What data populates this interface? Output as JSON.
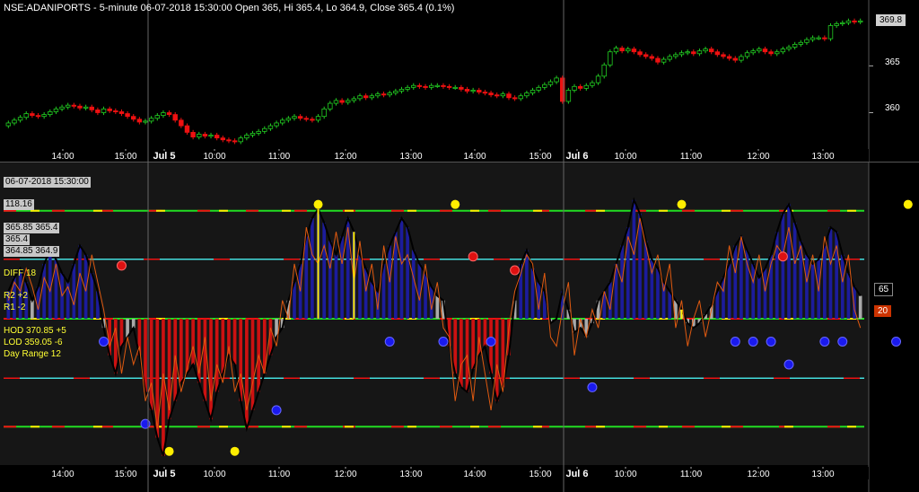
{
  "title": "NSE:ADANIPORTS - 5-minute 06-07-2018 15:30:00 Open 365, Hi 365.4, Lo 364.9, Close 365.4 (0.1%)",
  "price_axis": {
    "ticks": [
      "365",
      "360"
    ],
    "last_value": "369.8"
  },
  "time_axis": [
    "14:00",
    "15:00",
    "Jul 5",
    "10:00",
    "11:00",
    "12:00",
    "13:00",
    "14:00",
    "15:00",
    "Jul 6",
    "10:00",
    "11:00",
    "12:00",
    "13:00"
  ],
  "indicator_panel": {
    "datetime": "06-07-2018 15:30:00",
    "value_118": "118.16",
    "info_lines": [
      "365.85  365.4",
      "365.4",
      "364.85  364.9"
    ],
    "diff_label": "DIFF  18",
    "r2_label": "R2  +2",
    "r1_label": "R1  -2",
    "hod_label": "HOD  370.85  +5",
    "lod_label": "LOD  359.05   -6",
    "day_range_label": "Day Range    12",
    "right_value_1": "65",
    "right_value_2": "20"
  },
  "colors": {
    "up": "#22cc22",
    "down": "#ee1111",
    "green_line": "#22dd22",
    "cyan_line": "#44dddd",
    "yellow": "#ffee00",
    "navy_fill": "#1c1c9c",
    "red_fill": "#cc1111",
    "gray_fill": "#aaaaaa",
    "marker_blue": "#1a1aee",
    "marker_red": "#dd1111"
  },
  "chart_data": [
    {
      "type": "candlestick",
      "title": "NSE:ADANIPORTS - 5-minute",
      "y_ticks": [
        365,
        360
      ],
      "ylim": [
        356.5,
        370.5
      ],
      "last": 369.8,
      "close": [
        358.9,
        359.2,
        359.5,
        359.9,
        359.7,
        359.6,
        359.8,
        360.1,
        360.4,
        360.6,
        360.8,
        360.7,
        360.5,
        360.6,
        360.3,
        360.0,
        360.4,
        360.2,
        360.1,
        359.9,
        359.6,
        359.3,
        359.0,
        359.1,
        359.4,
        359.7,
        360.0,
        359.8,
        359.2,
        358.6,
        357.9,
        357.4,
        357.7,
        357.5,
        357.6,
        357.3,
        357.1,
        357.0,
        356.9,
        357.3,
        357.6,
        357.8,
        358.0,
        358.3,
        358.6,
        358.9,
        359.2,
        359.4,
        359.6,
        359.4,
        359.3,
        359.2,
        359.6,
        360.4,
        361.0,
        361.3,
        361.1,
        361.3,
        361.5,
        361.8,
        361.6,
        361.8,
        362.0,
        361.9,
        362.1,
        362.3,
        362.5,
        362.7,
        362.9,
        362.8,
        362.7,
        362.9,
        362.9,
        362.8,
        362.7,
        362.7,
        362.5,
        362.3,
        362.4,
        362.2,
        362.1,
        361.9,
        361.8,
        362.0,
        361.6,
        361.5,
        361.8,
        362.1,
        362.4,
        362.7,
        363.0,
        363.3,
        363.7,
        361.2,
        362.4,
        362.8,
        362.6,
        362.9,
        363.2,
        363.9,
        365.1,
        366.5,
        366.9,
        366.6,
        366.8,
        366.5,
        366.2,
        366.0,
        365.8,
        365.4,
        365.7,
        366.0,
        366.2,
        366.4,
        366.5,
        366.3,
        366.6,
        366.8,
        366.5,
        366.2,
        366.0,
        365.8,
        365.6,
        366.0,
        366.4,
        366.6,
        366.8,
        366.5,
        366.3,
        366.5,
        366.8,
        367.0,
        367.3,
        367.5,
        367.8,
        368.0,
        368.0,
        367.9,
        369.3,
        369.5,
        369.6,
        369.8,
        369.7,
        369.8
      ]
    },
    {
      "type": "area",
      "title": "oscillator",
      "y_labels": [
        "65",
        "20"
      ],
      "levels": [
        118,
        100,
        65,
        0,
        -65,
        -118
      ],
      "ylim": [
        -160,
        160
      ],
      "osc": [
        30,
        45,
        55,
        40,
        20,
        35,
        60,
        75,
        65,
        50,
        40,
        60,
        80,
        70,
        50,
        30,
        -10,
        -40,
        -60,
        -30,
        -20,
        -10,
        -40,
        -80,
        -100,
        -130,
        -150,
        -110,
        -90,
        -70,
        -60,
        -50,
        -70,
        -90,
        -110,
        -80,
        -60,
        -40,
        -50,
        -90,
        -120,
        -100,
        -80,
        -60,
        -40,
        -20,
        -10,
        20,
        40,
        60,
        90,
        110,
        120,
        105,
        85,
        70,
        90,
        110,
        95,
        70,
        55,
        40,
        30,
        60,
        80,
        95,
        110,
        100,
        75,
        60,
        50,
        35,
        25,
        20,
        -30,
        -60,
        -75,
        -80,
        -55,
        -40,
        -30,
        -60,
        -90,
        -75,
        -40,
        20,
        60,
        75,
        55,
        40,
        30,
        -5,
        0,
        30,
        10,
        -15,
        -10,
        -20,
        -5,
        20,
        30,
        40,
        60,
        80,
        100,
        130,
        115,
        85,
        65,
        55,
        40,
        30,
        20,
        10,
        -5,
        -10,
        -5,
        5,
        15,
        30,
        45,
        60,
        80,
        90,
        75,
        60,
        45,
        55,
        70,
        95,
        115,
        125,
        105,
        85,
        70,
        60,
        65,
        80,
        100,
        95,
        70,
        50,
        35,
        25
      ],
      "fast_line": [
        20,
        40,
        30,
        55,
        35,
        10,
        45,
        30,
        60,
        25,
        35,
        15,
        50,
        30,
        70,
        40,
        10,
        -30,
        -10,
        -60,
        -20,
        -50,
        -30,
        -90,
        -70,
        -120,
        -60,
        -100,
        -40,
        -80,
        -55,
        -30,
        -60,
        -20,
        -90,
        -50,
        -70,
        -30,
        -80,
        -60,
        -100,
        -70,
        -40,
        -60,
        -10,
        -30,
        20,
        0,
        60,
        30,
        100,
        70,
        60,
        80,
        55,
        95,
        60,
        100,
        40,
        85,
        30,
        60,
        10,
        80,
        40,
        90,
        60,
        70,
        45,
        20,
        60,
        10,
        40,
        -10,
        -20,
        -90,
        -50,
        -40,
        -90,
        -20,
        -60,
        -100,
        -50,
        -80,
        -10,
        30,
        50,
        70,
        60,
        10,
        50,
        -20,
        -30,
        10,
        40,
        -40,
        0,
        -20,
        10,
        -10,
        30,
        10,
        60,
        40,
        90,
        70,
        110,
        80,
        50,
        70,
        30,
        60,
        -10,
        20,
        -30,
        0,
        20,
        -20,
        10,
        40,
        30,
        80,
        50,
        90,
        60,
        40,
        70,
        30,
        60,
        80,
        70,
        100,
        60,
        80,
        40,
        70,
        30,
        90,
        60,
        80,
        40,
        70,
        10,
        -10
      ],
      "yellow_markers": [
        {
          "i": 27,
          "v": -145
        },
        {
          "i": 38,
          "v": -145
        },
        {
          "i": 52,
          "v": 125
        },
        {
          "i": 75,
          "v": 125
        },
        {
          "i": 113,
          "v": 125
        },
        {
          "i": 151,
          "v": 125
        }
      ],
      "blue_markers": [
        {
          "i": 16,
          "v": -25
        },
        {
          "i": 23,
          "v": -115
        },
        {
          "i": 45,
          "v": -100
        },
        {
          "i": 64,
          "v": -25
        },
        {
          "i": 73,
          "v": -25
        },
        {
          "i": 81,
          "v": -25
        },
        {
          "i": 98,
          "v": -75
        },
        {
          "i": 122,
          "v": -25
        },
        {
          "i": 125,
          "v": -25
        },
        {
          "i": 128,
          "v": -25
        },
        {
          "i": 131,
          "v": -50
        },
        {
          "i": 137,
          "v": -25
        },
        {
          "i": 140,
          "v": -25
        },
        {
          "i": 149,
          "v": -25
        }
      ],
      "red_markers": [
        {
          "i": 19,
          "v": 58
        },
        {
          "i": 78,
          "v": 68
        },
        {
          "i": 85,
          "v": 53
        },
        {
          "i": 130,
          "v": 68
        }
      ]
    }
  ]
}
